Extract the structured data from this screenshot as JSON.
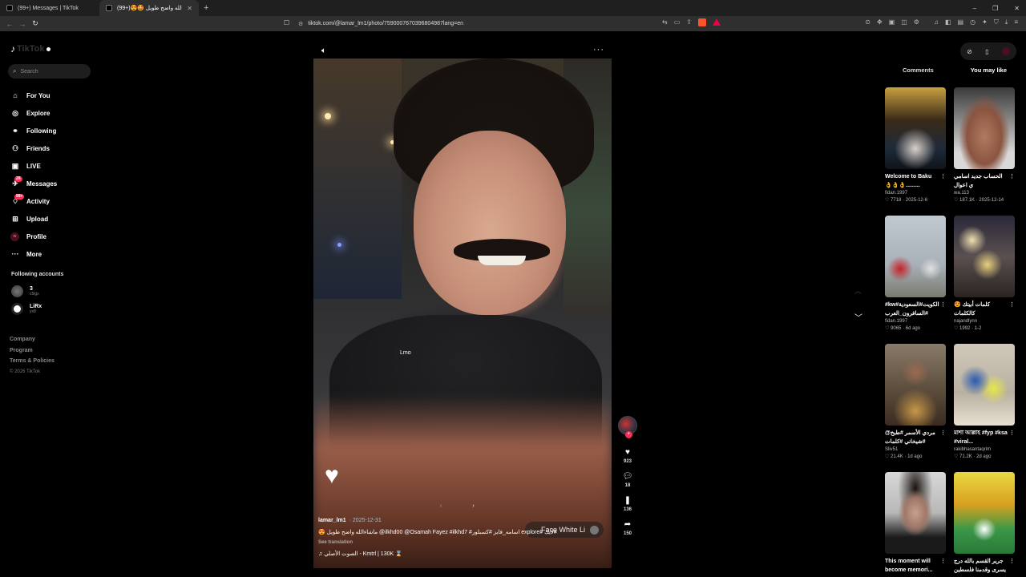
{
  "browser": {
    "tabs": [
      {
        "label": "(99+) Messages | TikTok",
        "active": false
      },
      {
        "label": "(99+)😍🤩 ماشاءالله واضح طويل",
        "active": true
      }
    ],
    "url": "tiktok.com/@lamar_lm1/photo/7590007670396804987lang=en",
    "window_controls": [
      "–",
      "❐",
      "✕"
    ]
  },
  "sidebar": {
    "search_placeholder": "Search",
    "nav": [
      {
        "label": "For You",
        "icon": "home-icon"
      },
      {
        "label": "Explore",
        "icon": "compass-icon"
      },
      {
        "label": "Following",
        "icon": "following-icon"
      },
      {
        "label": "Friends",
        "icon": "friends-icon"
      },
      {
        "label": "LIVE",
        "icon": "live-icon"
      },
      {
        "label": "Messages",
        "icon": "messages-icon",
        "badge": "28"
      },
      {
        "label": "Activity",
        "icon": "activity-icon",
        "badge": "99+"
      },
      {
        "label": "Upload",
        "icon": "upload-icon"
      },
      {
        "label": "Profile",
        "icon": "profile-icon"
      },
      {
        "label": "More",
        "icon": "more-icon"
      }
    ],
    "following_title": "Following accounts",
    "following": [
      {
        "name": "3",
        "sub": "c5lgs"
      },
      {
        "name": "LiRx",
        "sub": "yx8"
      }
    ],
    "footer": {
      "company": "Company",
      "program": "Program",
      "terms": "Terms & Policies",
      "copyright": "© 2026 TikTok"
    }
  },
  "video": {
    "overlay_text": "Lmo",
    "face_pill": "Face White Li",
    "author": "lamar_lm1",
    "date": "· 2025-12-31",
    "caption": "😍 ماشاءالله واضح طويل @ilkhd00 @Osamah Fayez #ilkhd7 #اسامه_فايز #كسبلور explore# لايك#",
    "see_translation": "See translation",
    "music": "♫  الصوت الأصلي - Kmtrl | 130K ⌛",
    "likes": "923",
    "comments": "18",
    "saves": "136",
    "shares": "150"
  },
  "right_panel": {
    "tab_comments": "Comments",
    "tab_you_may_like": "You may like",
    "cards": [
      {
        "title": "Welcome to Baku 👌👌👌.........",
        "user": "fidan.1997",
        "likes": "7718",
        "date": "2025-12-6"
      },
      {
        "title": "الحساب جديد اسامي ي اعوال",
        "user": "wa.113",
        "likes": "187.1K",
        "date": "2025-12-14"
      },
      {
        "title": "#kw#الكويت#السعودية #السافرون_العرب",
        "user": "fidan.1997",
        "likes": "9065",
        "date": "6d ago"
      },
      {
        "title": "😍 كلمات أبيتك كالكلمات #vacationmode...",
        "user": "najandlynn",
        "likes": "1992",
        "date": "1-2"
      },
      {
        "title": "@مردي الأسمر #طبخ #شيخاني #كلمات",
        "user": "Sliv51",
        "likes": "21.4K",
        "date": "1d ago"
      },
      {
        "title": "মাশা আল্লাহ #fyp #ksa #viral...",
        "user": "rakibhasantaqrim",
        "likes": "71.2K",
        "date": "2d ago"
      },
      {
        "title": "This moment will become memori...",
        "user": "",
        "likes": "",
        "date": ""
      },
      {
        "title": "جرير القسم بالله درج يسرى وقدمنا فلسطين",
        "user": "",
        "likes": "",
        "date": ""
      }
    ]
  }
}
